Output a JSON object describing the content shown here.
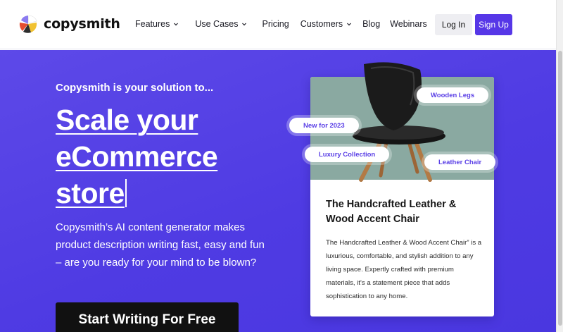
{
  "brand": {
    "name": "copysmith",
    "logo_colors": [
      "#8b7bf0",
      "#e44c2f",
      "#f1c232",
      "#2d2d2d"
    ]
  },
  "nav": {
    "items": [
      {
        "label": "Features",
        "has_dropdown": true
      },
      {
        "label": "Use Cases",
        "has_dropdown": true
      },
      {
        "label": "Pricing",
        "has_dropdown": false
      },
      {
        "label": "Customers",
        "has_dropdown": true
      },
      {
        "label": "Blog",
        "has_dropdown": false
      },
      {
        "label": "Webinars",
        "has_dropdown": false
      }
    ],
    "login_label": "Log In",
    "signup_label": "Sign Up"
  },
  "hero": {
    "kicker": "Copysmith is your solution to...",
    "headline_lines": [
      "Scale your",
      "eCommerce",
      "store"
    ],
    "subtext": "Copysmith’s AI content generator makes product description writing fast, easy and fun – are you ready for your mind to be blown?",
    "cta_label": "Start Writing For Free"
  },
  "product_card": {
    "tags": [
      "Wooden Legs",
      "New for 2023",
      "Luxury Collection",
      "Leather Chair"
    ],
    "title": "The Handcrafted Leather & Wood Accent Chair",
    "description": "The Handcrafted Leather & Wood Accent Chair” is a luxurious, comfortable, and stylish addition to any living space. Expertly crafted with premium materials, it's a statement piece that adds sophistication to any home."
  },
  "colors": {
    "accent": "#5637e7",
    "hero_bg": "#5040e4",
    "cta_bg": "#111111",
    "image_bg": "#8aa9a1"
  }
}
